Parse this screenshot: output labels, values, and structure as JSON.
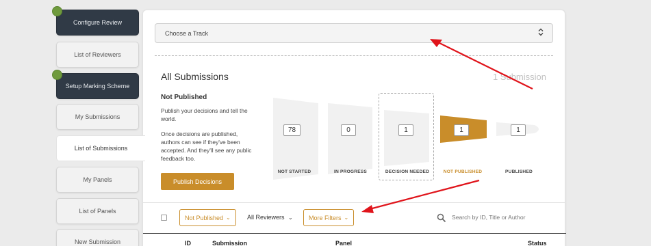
{
  "sidebar": {
    "items": [
      {
        "label": "Configure Review",
        "status_dot": true
      },
      {
        "label": "List of Reviewers"
      },
      {
        "label": "Setup Marking Scheme",
        "status_dot": true
      },
      {
        "label": "My Submissions"
      },
      {
        "label": "List of Submissions",
        "active": true
      },
      {
        "label": "My Panels"
      },
      {
        "label": "List of Panels"
      },
      {
        "label": "New Submission"
      }
    ]
  },
  "main": {
    "track_select": {
      "placeholder": "Choose a Track"
    },
    "section_title": "All Submissions",
    "submission_count": "1 Submission",
    "info": {
      "title": "Not Published",
      "text1": "Publish your decisions and tell the world.",
      "text2": "Once decisions are published, authors can see if they've been accepted. And they'll see any public feedback too.",
      "publish_button": "Publish Decisions"
    },
    "stages": [
      {
        "label": "NOT STARTED",
        "count": "78"
      },
      {
        "label": "IN PROGRESS",
        "count": "0"
      },
      {
        "label": "DECISION NEEDED",
        "count": "1"
      },
      {
        "label": "NOT PUBLISHED",
        "count": "1",
        "active": true
      },
      {
        "label": "PUBLISHED",
        "count": "1"
      }
    ],
    "filters": {
      "status_filter": "Not Published",
      "reviewers_filter": "All Reviewers",
      "more_filters": "More Filters",
      "search_placeholder": "Search by ID, Title or Author"
    },
    "table": {
      "columns": [
        "ID",
        "Submission",
        "Panel",
        "Status"
      ]
    }
  },
  "colors": {
    "accent": "#c98d2a",
    "dark_nav": "#303a46",
    "status_green": "#6f9a3d",
    "annotation_arrow": "#e0141b"
  }
}
